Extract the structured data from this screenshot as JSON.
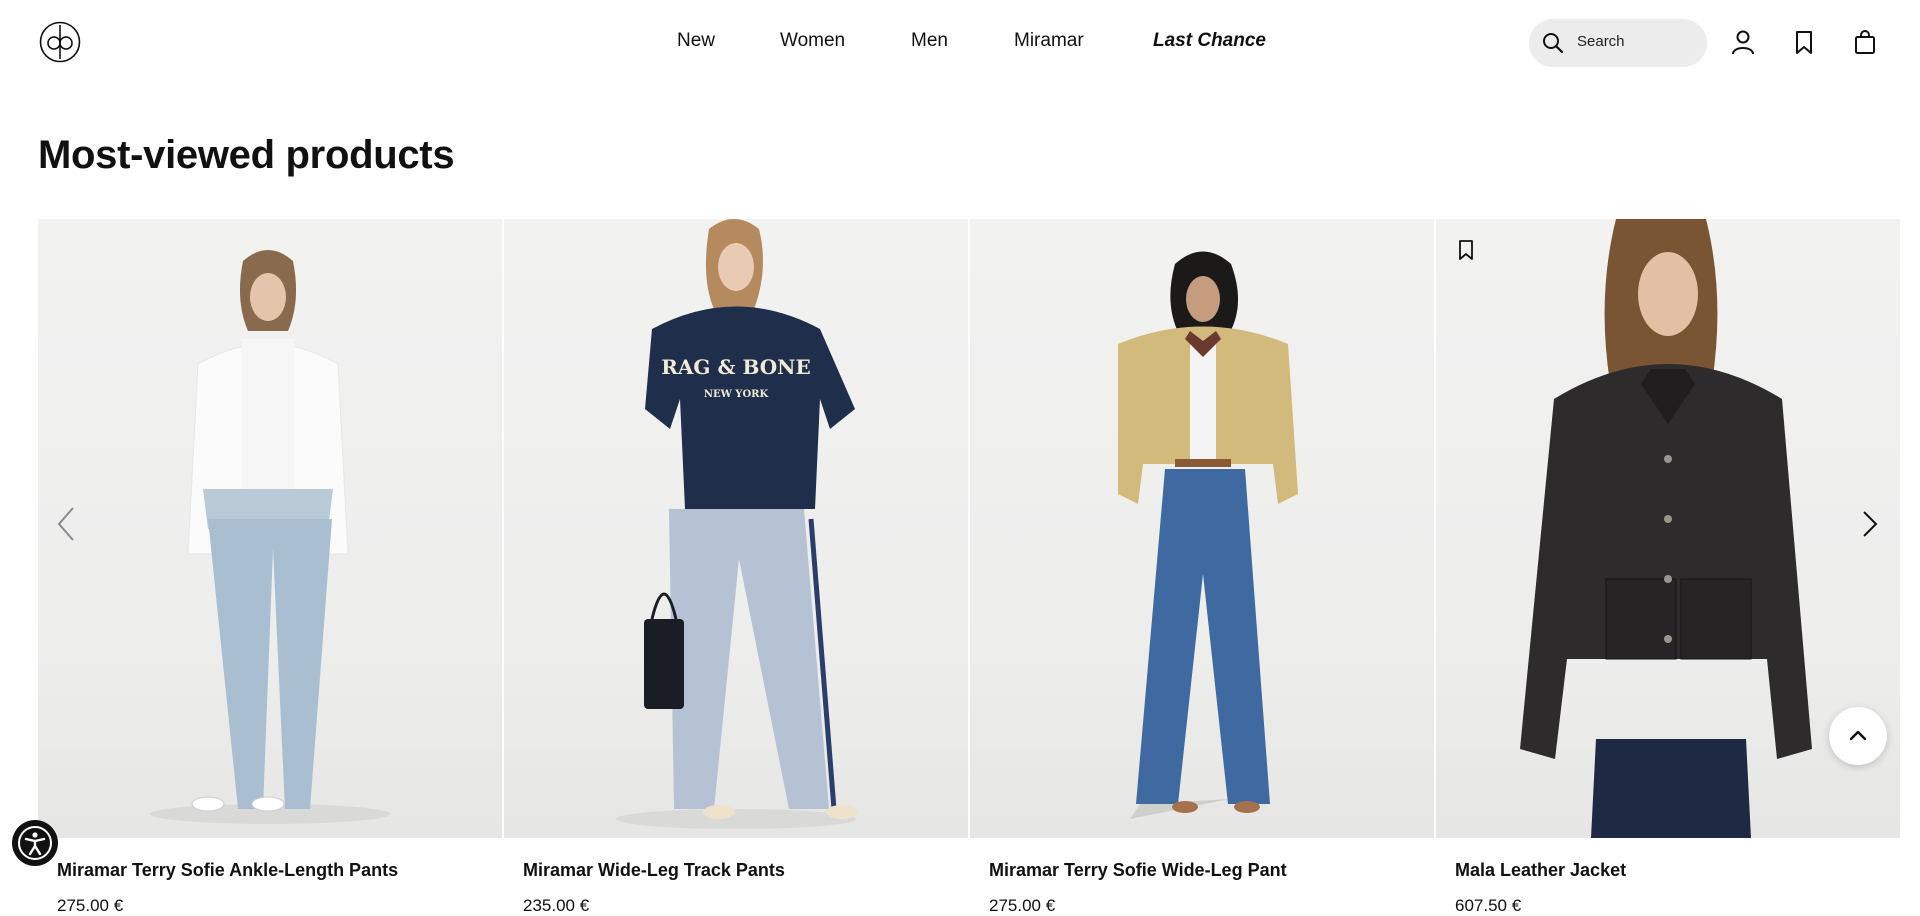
{
  "header": {
    "nav": [
      {
        "label": "New"
      },
      {
        "label": "Women"
      },
      {
        "label": "Men"
      },
      {
        "label": "Miramar"
      },
      {
        "label": "Last Chance"
      }
    ],
    "search": {
      "placeholder": "Search"
    },
    "icons": [
      "logo-icon",
      "search-icon",
      "account-icon",
      "wishlist-icon",
      "bag-icon"
    ]
  },
  "section": {
    "title": "Most-viewed products"
  },
  "products": [
    {
      "name": "Miramar Terry Sofie Ankle-Length Pants",
      "price": "275.00 €"
    },
    {
      "name": "Miramar Wide-Leg Track Pants",
      "price": "235.00 €"
    },
    {
      "name": "Miramar Terry Sofie Wide-Leg Pant",
      "price": "275.00 €"
    },
    {
      "name": "Mala Leather Jacket",
      "price": "607.50 €"
    }
  ],
  "colors": {
    "background": "#ffffff",
    "text": "#111111",
    "search_bg": "#ececec",
    "image_bg": "#efefee"
  }
}
